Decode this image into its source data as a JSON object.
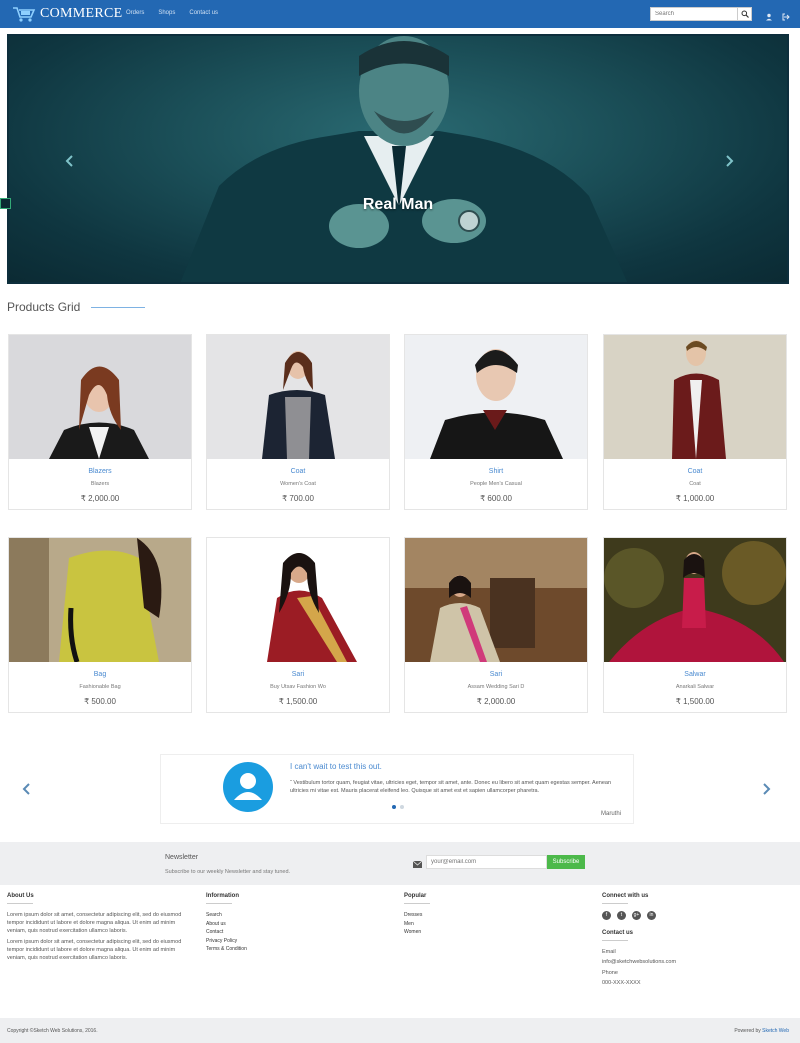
{
  "header": {
    "brand": "COMMERCE",
    "nav": [
      "Orders",
      "Shops",
      "Contact us"
    ],
    "search_placeholder": "Search"
  },
  "hero": {
    "title": "Real Man"
  },
  "products_section": {
    "title": "Products Grid"
  },
  "products": [
    {
      "name": "Blazers",
      "category": "Blazers",
      "price": "₹ 2,000.00"
    },
    {
      "name": "Coat",
      "category": "Women's Coat",
      "price": "₹ 700.00"
    },
    {
      "name": "Shirt",
      "category": "People Men's Casual",
      "price": "₹ 600.00"
    },
    {
      "name": "Coat",
      "category": "Coat",
      "price": "₹ 1,000.00"
    },
    {
      "name": "Bag",
      "category": "Fashionable Bag",
      "price": "₹ 500.00"
    },
    {
      "name": "Sari",
      "category": "Buy Utsav Fashion Wo",
      "price": "₹ 1,500.00"
    },
    {
      "name": "Sari",
      "category": "Assam Wedding Sari D",
      "price": "₹ 2,000.00"
    },
    {
      "name": "Salwar",
      "category": "Anarkali Salwar",
      "price": "₹ 1,500.00"
    }
  ],
  "testimonial": {
    "title": "I can't wait to test this out.",
    "text": "Vestibulum tortor quam, feugiat vitae, ultricies eget, tempor sit amet, ante. Donec eu libero sit amet quam egestas semper. Aenean ultricies mi vitae est. Mauris placerat eleifend leo. Quisque sit amet est et sapien ullamcorper pharetra.",
    "author": "Maruthi"
  },
  "newsletter": {
    "title": "Newsletter",
    "subtitle": "Subscribe to our weekly Newsletter and stay tuned.",
    "email_placeholder": "your@email.com",
    "button": "Subscribe"
  },
  "footer": {
    "about": {
      "heading": "About Us",
      "para1": "Lorem ipsum dolor sit amet, consectetur adipiscing elit, sed do eiusmod tempor incididunt ut labore et dolore magna aliqua. Ut enim ad minim veniam, quis nostrud exercitation ullamco laboris.",
      "para2": "Lorem ipsum dolor sit amet, consectetur adipiscing elit, sed do eiusmod tempor incididunt ut labore et dolore magna aliqua. Ut enim ad minim veniam, quis nostrud exercitation ullamco laboris."
    },
    "information": {
      "heading": "Information",
      "links": [
        "Search",
        "About us",
        "Contact",
        "Privacy Policy",
        "Terms & Condition"
      ]
    },
    "popular": {
      "heading": "Popular",
      "links": [
        "Dresses",
        "Men",
        "Women"
      ]
    },
    "connect": {
      "heading": "Connect with us",
      "social": [
        "f",
        "t",
        "g+",
        "in"
      ],
      "contact_heading": "Contact us",
      "email_label": "Email",
      "email": "info@sketchwebsolutions.com",
      "phone_label": "Phone",
      "phone": "000-XXX-XXXX"
    },
    "copyright": "Copyright ©Sketch Web Solutions, 2016.",
    "powered_prefix": "Powered by ",
    "powered_link": "Sketch Web"
  },
  "colors": {
    "brand_blue": "#2368b3",
    "subscribe_green": "#4cb94a",
    "link_blue": "#4a8ad0"
  }
}
